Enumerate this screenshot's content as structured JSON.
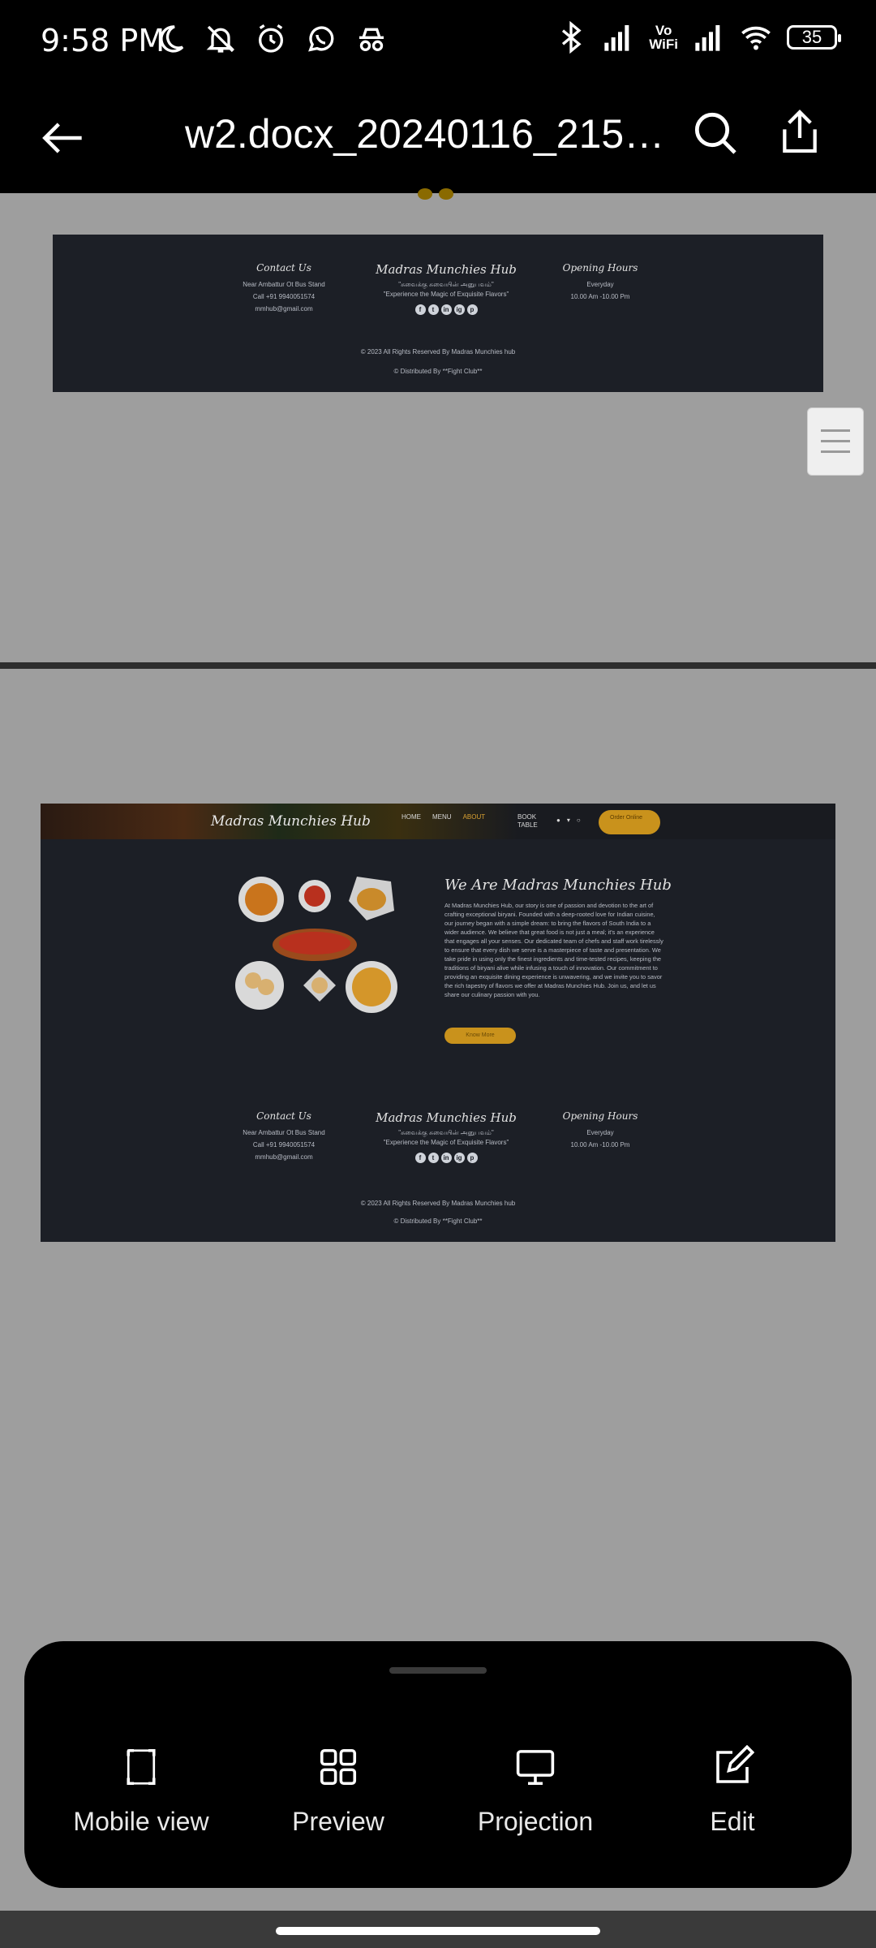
{
  "status_bar": {
    "time": "9:58 PM",
    "battery": "35",
    "left_icons": [
      "moon-icon",
      "bell-off-icon",
      "alarm-icon",
      "whatsapp-icon",
      "incognito-icon"
    ],
    "right_icons": [
      "bluetooth-icon",
      "signal-icon",
      "vowifi-icon",
      "signal-2-icon",
      "wifi-icon",
      "battery-icon"
    ],
    "vowifi_top": "Vo",
    "vowifi_bottom": "WiFi"
  },
  "app_bar": {
    "title": "w2.docx_20240116_2155..."
  },
  "footer": {
    "contact_title": "Contact Us",
    "address": "Near Ambattur Ot Bus Stand",
    "phone": "Call +91 9940051574",
    "email": "mmhub@gmail.com",
    "brand": "Madras Munchies Hub",
    "tamil_tagline": "\"சுவைக்கு சுவையின் அனுபவம்\"",
    "tagline": "\"Experience the Magic of Exquisite Flavors\"",
    "hours_title": "Opening Hours",
    "hours_days": "Everyday",
    "hours_time": "10.00 Am -10.00 Pm",
    "rights": "© 2023 All Rights Reserved By Madras Munchies hub",
    "distributed": "© Distributed By **Fight Club**",
    "social": [
      "f",
      "t",
      "in",
      "ig",
      "p"
    ]
  },
  "site": {
    "logo": "Madras Munchies Hub",
    "nav": [
      "HOME",
      "MENU",
      "ABOUT"
    ],
    "active_nav": "ABOUT",
    "book_table": "BOOK TABLE",
    "order_button": "Order Online",
    "about_title": "We Are Madras Munchies Hub",
    "about_body": "At Madras Munchies Hub, our story is one of passion and devotion to the art of crafting exceptional biryani. Founded with a deep-rooted love for Indian cuisine, our journey began with a simple dream: to bring the flavors of South India to a wider audience. We believe that great food is not just a meal; it's an experience that engages all your senses. Our dedicated team of chefs and staff work tirelessly to ensure that every dish we serve is a masterpiece of taste and presentation. We take pride in using only the finest ingredients and time-tested recipes, keeping the traditions of biryani alive while infusing a touch of innovation. Our commitment to providing an exquisite dining experience is unwavering, and we invite you to savor the rich tapestry of flavors we offer at Madras Munchies Hub. Join us, and let us share our culinary passion with you.",
    "know_more": "Know More"
  },
  "bottom_sheet": {
    "actions": [
      {
        "label": "Mobile view",
        "icon": "mobile-view-icon"
      },
      {
        "label": "Preview",
        "icon": "grid-icon"
      },
      {
        "label": "Projection",
        "icon": "monitor-icon"
      },
      {
        "label": "Edit",
        "icon": "edit-icon"
      }
    ]
  },
  "colors": {
    "accent": "#c9921c",
    "site_bg": "#1c1f26",
    "viewer_bg": "#9e9e9e"
  }
}
